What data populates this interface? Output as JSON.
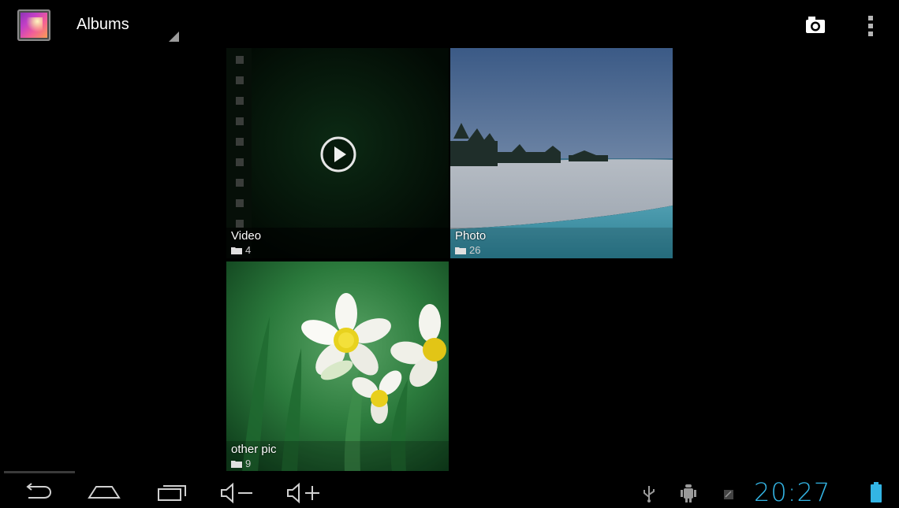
{
  "actionbar": {
    "title": "Albums",
    "app_icon": "gallery-icon",
    "camera_icon": "camera-icon",
    "overflow_icon": "overflow-menu-icon"
  },
  "albums": [
    {
      "name": "Video",
      "count": "4",
      "thumbnail": "video-film-strip-with-play-icon"
    },
    {
      "name": "Photo",
      "count": "26",
      "thumbnail": "beach-photo"
    },
    {
      "name": "other pic",
      "count": "9",
      "thumbnail": "daffodil-flowers-photo"
    }
  ],
  "systembar": {
    "back_icon": "back-icon",
    "home_icon": "home-icon",
    "recents_icon": "recent-apps-icon",
    "volume_down_icon": "volume-down-icon",
    "volume_up_icon": "volume-up-icon",
    "usb_icon": "usb-icon",
    "debug_icon": "android-debug-icon",
    "notification_icon": "notification-icon",
    "clock": "20:27",
    "battery_icon": "battery-icon"
  },
  "colors": {
    "background": "#000000",
    "clock": "#33b5e5",
    "battery": "#33b5e5"
  }
}
